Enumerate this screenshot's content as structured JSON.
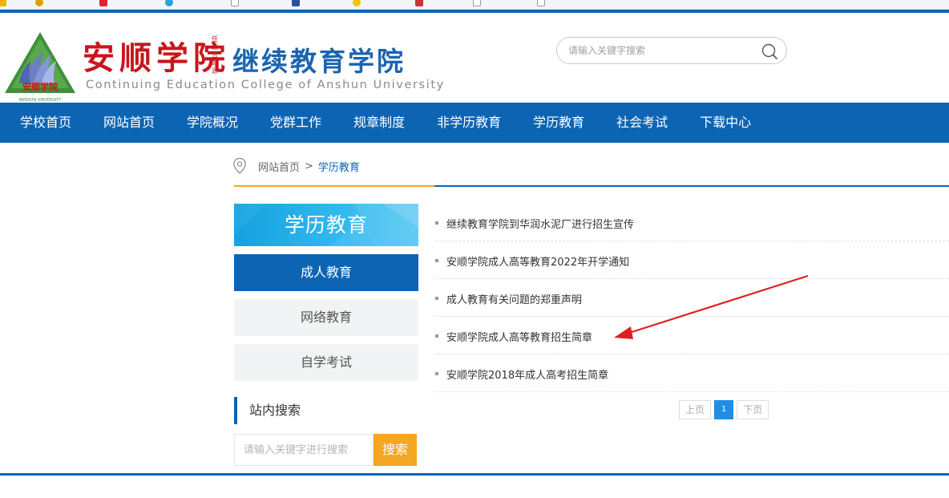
{
  "header": {
    "logo_cn": "安顺学院",
    "seal_text": "任运合题源",
    "college_cn": "继续教育学院",
    "college_en": "Continuing Education College of Anshun University",
    "emblem_caption": "安顺学院",
    "search_placeholder": "请输入关键字搜索"
  },
  "nav": {
    "items": [
      "学校首页",
      "网站首页",
      "学院概况",
      "党群工作",
      "规章制度",
      "非学历教育",
      "学历教育",
      "社会考试",
      "下载中心"
    ]
  },
  "breadcrumb": {
    "home": "网站首页",
    "separator": ">",
    "current": "学历教育"
  },
  "sidebar": {
    "banner_title": "学历教育",
    "items": [
      {
        "label": "成人教育",
        "active": true
      },
      {
        "label": "网络教育",
        "active": false
      },
      {
        "label": "自学考试",
        "active": false
      }
    ],
    "search_title": "站内搜索",
    "search_placeholder": "请输入关键字进行搜索",
    "search_button": "搜索"
  },
  "news": {
    "items": [
      "继续教育学院到华润水泥厂进行招生宣传",
      "安顺学院成人高等教育2022年开学通知",
      "成人教育有关问题的郑重声明",
      "安顺学院成人高等教育招生简章",
      "安顺学院2018年成人高考招生简章"
    ]
  },
  "pager": {
    "prev": "上页",
    "current": "1",
    "next": "下页"
  },
  "colors": {
    "brand_blue": "#0d64b3",
    "accent_orange": "#f5a623",
    "logo_red": "#c8161d",
    "annotation_red": "#e02020"
  }
}
